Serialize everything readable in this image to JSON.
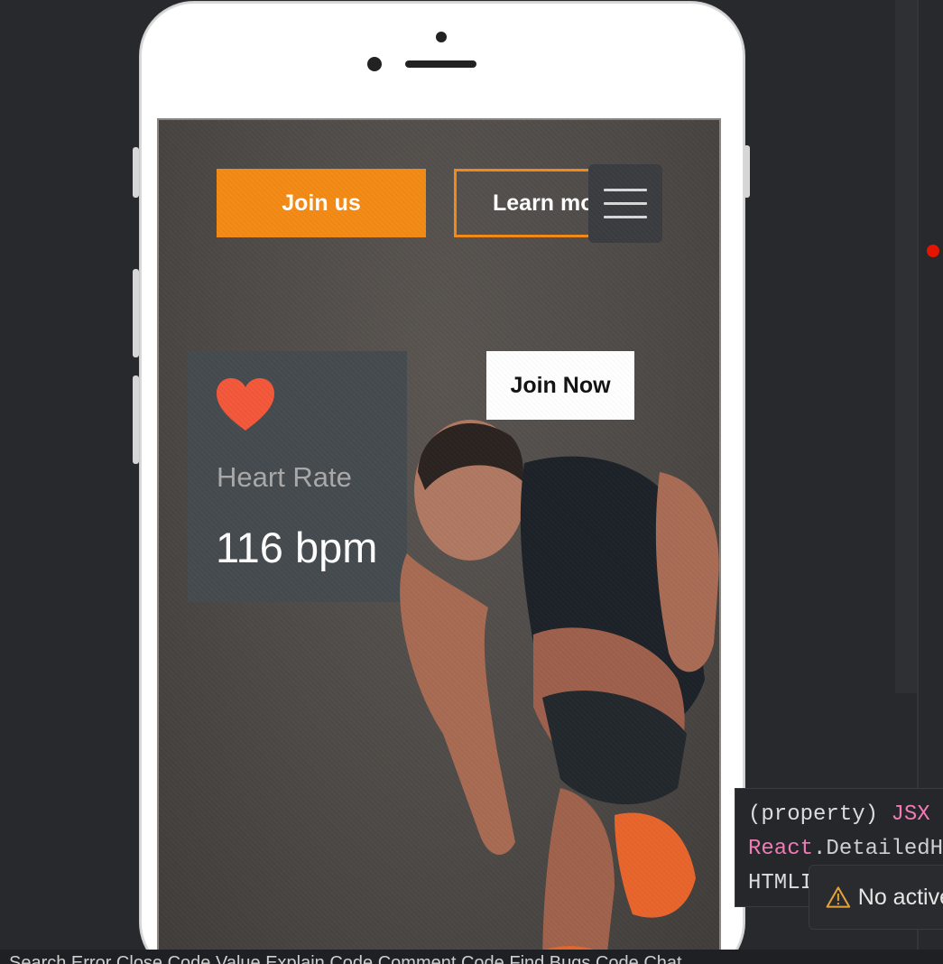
{
  "app": {
    "buttons": {
      "join_us": "Join us",
      "learn_more": "Learn more",
      "join_now": "Join Now"
    },
    "heart_rate": {
      "label": "Heart Rate",
      "value": "116 bpm"
    }
  },
  "tooltip": {
    "line1_a": "(property) ",
    "line1_b": "JSX",
    "line2_a": "React",
    "line2_b": ".DetailedH",
    "line3": "HTMLI"
  },
  "warning": {
    "text": "No active"
  },
  "statusbar": {
    "text": "Search Error    Close Code Value    Explain Code    Comment Code    Find Bugs    Code Chat"
  },
  "colors": {
    "accent": "#f38a14",
    "heart": "#f4583a",
    "card_bg": "#454a4f",
    "breakpoint": "#e51400"
  }
}
